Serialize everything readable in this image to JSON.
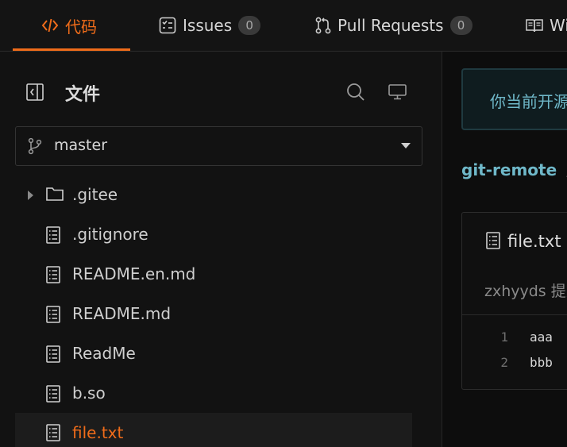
{
  "tabs": [
    {
      "label": "代码",
      "active": true,
      "icon": "code-icon"
    },
    {
      "label": "Issues",
      "count": "0",
      "icon": "issues-icon"
    },
    {
      "label": "Pull Requests",
      "count": "0",
      "icon": "pull-request-icon"
    },
    {
      "label": "Wiki",
      "icon": "book-icon"
    }
  ],
  "sidebar": {
    "title": "文件",
    "branch": "master",
    "items": [
      {
        "label": ".gitee",
        "type": "folder"
      },
      {
        "label": ".gitignore",
        "type": "file"
      },
      {
        "label": "README.en.md",
        "type": "file"
      },
      {
        "label": "README.md",
        "type": "file"
      },
      {
        "label": "ReadMe",
        "type": "file"
      },
      {
        "label": "b.so",
        "type": "file"
      },
      {
        "label": "file.txt",
        "type": "file",
        "selected": true
      }
    ]
  },
  "main": {
    "notice": "你当前开源",
    "breadcrumb": {
      "repo": "git-remote",
      "sep": "/"
    },
    "file": {
      "name": "file.txt",
      "commit": "zxhyyds 提交",
      "lines": [
        {
          "num": "1",
          "text": "aaa"
        },
        {
          "num": "2",
          "text": "bbb"
        }
      ]
    }
  },
  "colors": {
    "accent": "#ef6c1a",
    "link": "#6fb8c9",
    "background": "#0d0d0d"
  }
}
